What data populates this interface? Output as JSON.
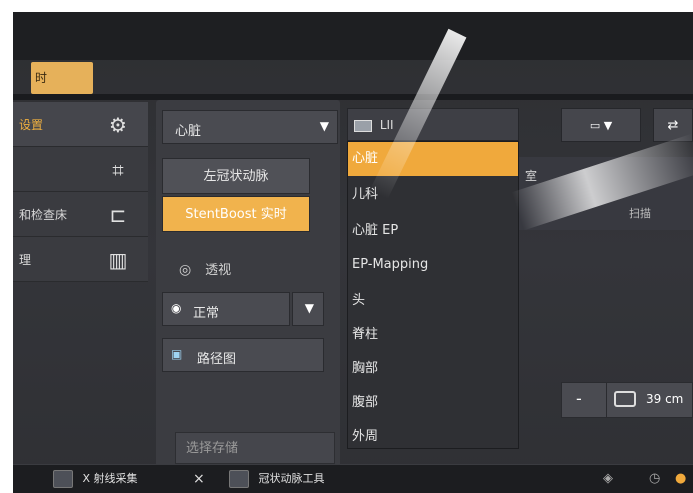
{
  "top_tab_label": "时",
  "nav": {
    "items": [
      {
        "label": "设置",
        "icon": "settings-icon"
      },
      {
        "label": "",
        "icon": "crop-icon"
      },
      {
        "label": "和检查床",
        "icon": "table-icon"
      },
      {
        "label": "理",
        "icon": "sliders-icon"
      }
    ]
  },
  "protocol_select": {
    "value": "心脏"
  },
  "buttons": {
    "lca_label": "左冠状动脉",
    "stentboost_label": "StentBoost 实时"
  },
  "view": {
    "label": "透视"
  },
  "mode_select": {
    "value": "正常"
  },
  "roadmap": {
    "label": "路径图"
  },
  "store_label": "选择存储",
  "dropdown": {
    "head": "LII",
    "items": [
      "心脏",
      "儿科",
      "心脏 EP",
      "EP-Mapping",
      "头",
      "脊柱",
      "胸部",
      "腹部",
      "外周"
    ]
  },
  "right_panel": {
    "row_text": "室",
    "row_text2": "扫描"
  },
  "zoom": {
    "value": "39 cm",
    "minus_label": "-"
  },
  "taskbar": {
    "tab1": "X 射线采集",
    "close": "×",
    "tab2": "冠状动脉工具"
  }
}
